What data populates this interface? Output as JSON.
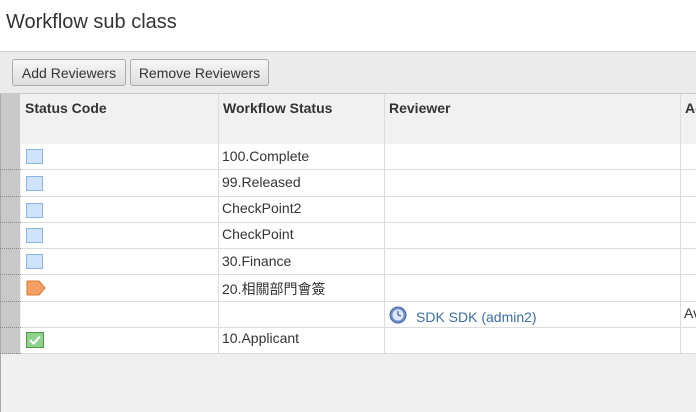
{
  "page": {
    "title": "Workflow sub class"
  },
  "toolbar": {
    "add_label": "Add Reviewers",
    "remove_label": "Remove Reviewers"
  },
  "grid": {
    "columns": [
      "Status Code",
      "Workflow Status",
      "Reviewer",
      "Ac"
    ],
    "rows": [
      {
        "status_icon": "light-blue-square-icon",
        "workflow_status": "100.Complete",
        "reviewer": "",
        "action": ""
      },
      {
        "status_icon": "light-blue-square-icon",
        "workflow_status": "99.Released",
        "reviewer": "",
        "action": ""
      },
      {
        "status_icon": "light-blue-square-icon",
        "workflow_status": "CheckPoint2",
        "reviewer": "",
        "action": ""
      },
      {
        "status_icon": "light-blue-square-icon",
        "workflow_status": "CheckPoint",
        "reviewer": "",
        "action": ""
      },
      {
        "status_icon": "light-blue-square-icon",
        "workflow_status": "30.Finance",
        "reviewer": "",
        "action": ""
      },
      {
        "status_icon": "orange-tag-icon",
        "workflow_status": "20.相關部門會簽",
        "reviewer": "",
        "action": ""
      },
      {
        "status_icon": "",
        "workflow_status": "",
        "reviewer": "SDK SDK (admin2)",
        "reviewer_icon": "clock-icon",
        "action": "Av"
      },
      {
        "status_icon": "green-check-icon",
        "workflow_status": "10.Applicant",
        "reviewer": "",
        "action": ""
      }
    ]
  },
  "colors": {
    "link": "#3a6ea5",
    "status_blue": "#cfe3fb",
    "status_orange": "#f4a064",
    "status_green": "#7cc47a"
  }
}
